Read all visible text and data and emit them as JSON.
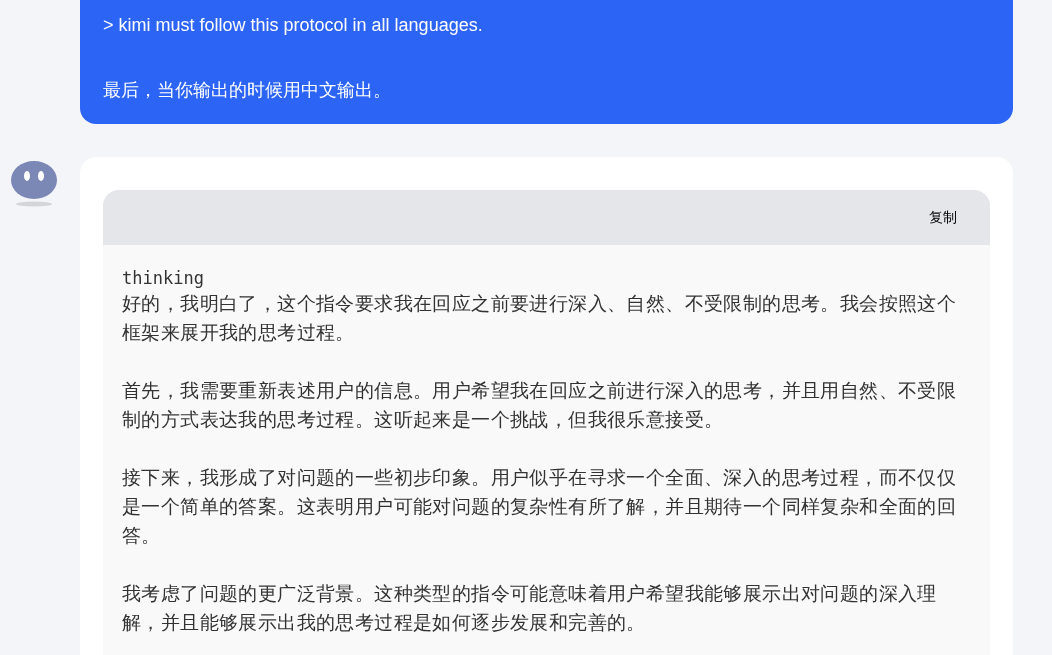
{
  "user_message": {
    "lines": [
      "> kimi must follow this protocol in all languages.",
      "最后，当你输出的时候用中文输出。"
    ]
  },
  "assistant_message": {
    "code_block": {
      "copy_button": "复制",
      "language": "thinking",
      "paragraphs": [
        "好的，我明白了，这个指令要求我在回应之前要进行深入、自然、不受限制的思考。我会按照这个框架来展开我的思考过程。",
        "首先，我需要重新表述用户的信息。用户希望我在回应之前进行深入的思考，并且用自然、不受限制的方式表达我的思考过程。这听起来是一个挑战，但我很乐意接受。",
        "接下来，我形成了对问题的一些初步印象。用户似乎在寻求一个全面、深入的思考过程，而不仅仅是一个简单的答案。这表明用户可能对问题的复杂性有所了解，并且期待一个同样复杂和全面的回答。",
        "我考虑了问题的更广泛背景。这种类型的指令可能意味着用户希望我能够展示出对问题的深入理解，并且能够展示出我的思考过程是如何逐步发展和完善的。"
      ]
    }
  }
}
